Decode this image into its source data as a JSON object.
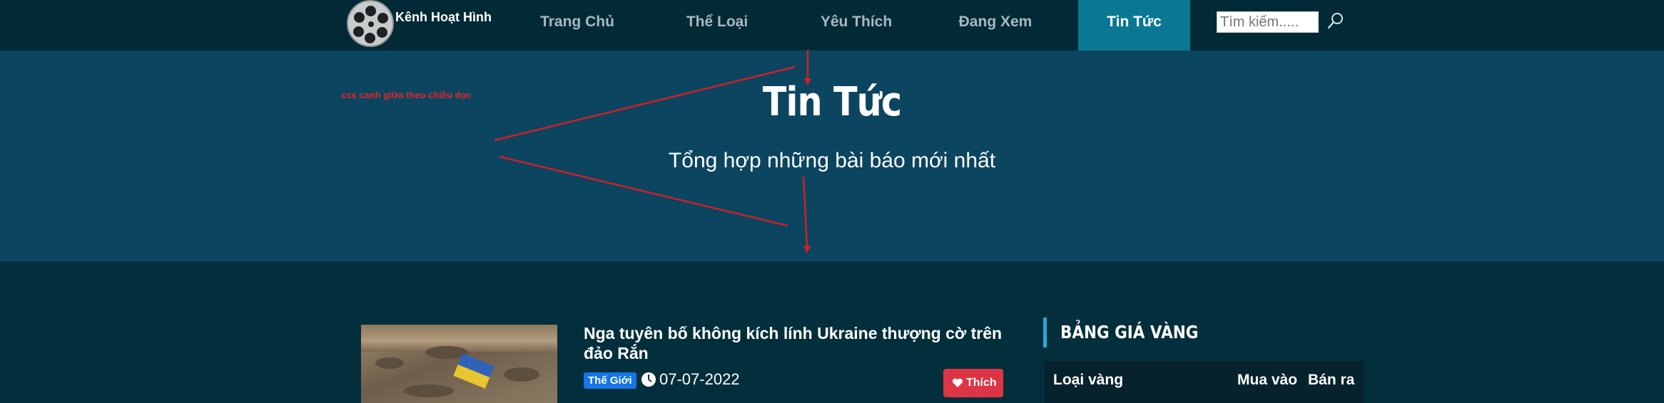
{
  "brand": {
    "logo_text": "Kênh Hoạt Hình"
  },
  "nav": {
    "items": [
      {
        "label": "Trang Chủ"
      },
      {
        "label": "Thể Loại"
      },
      {
        "label": "Yêu Thích"
      },
      {
        "label": "Đang Xem"
      },
      {
        "label": "Tin Tức",
        "active": true
      }
    ],
    "search_placeholder": "Tìm kiếm.....",
    "active_color": "#0b7893"
  },
  "hero": {
    "title": "Tin Tức",
    "subtitle": "Tổng hợp những bài báo mới nhất",
    "annotation": "css canh giữa theo chiều dọc",
    "annotation_color": "#e0262b"
  },
  "news": [
    {
      "title": "Nga tuyên bố không kích lính Ukraine thượng cờ trên đảo Rắn",
      "category": "Thế Giới",
      "date": "07-07-2022",
      "like_label": "Thích"
    }
  ],
  "gold_widget": {
    "title": "BẢNG GIÁ VÀNG",
    "columns": [
      "Loại vàng",
      "Mua vào",
      "Bán ra"
    ]
  },
  "colors": {
    "page_bg": "#032f3d",
    "hero_bg": "#0b4560",
    "tag_bg": "#1674e6",
    "like_bg": "#dc3545",
    "accent_bar": "#2aa8d8"
  }
}
